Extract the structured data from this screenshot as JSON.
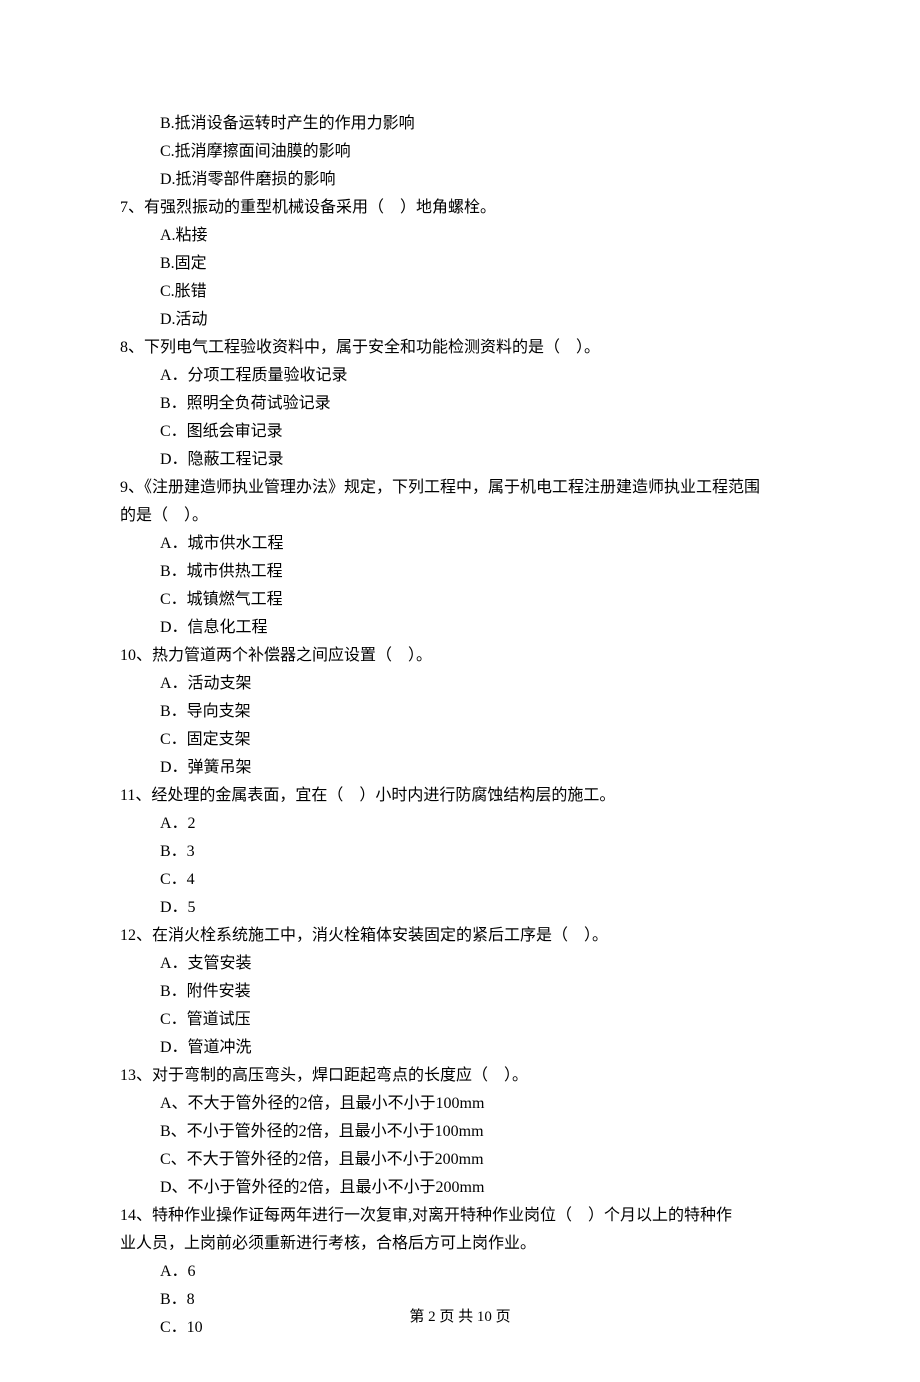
{
  "body": {
    "orphan_options": [
      "B.抵消设备运转时产生的作用力影响",
      "C.抵消摩擦面间油膜的影响",
      "D.抵消零部件磨损的影响"
    ],
    "questions": [
      {
        "num": "7",
        "stem_before": "、有强烈振动的重型机械设备采用（",
        "stem_after": "）地角螺栓。",
        "options": [
          "A.粘接",
          "B.固定",
          "C.胀错",
          "D.活动"
        ]
      },
      {
        "num": "8",
        "stem_before": "、下列电气工程验收资料中，属于安全和功能检测资料的是（",
        "stem_after": "）。",
        "options": [
          "A．分项工程质量验收记录",
          "B．照明全负荷试验记录",
          "C．图纸会审记录",
          "D．隐蔽工程记录"
        ]
      },
      {
        "num": "9",
        "stem_before": "、《注册建造师执业管理办法》规定，下列工程中，属于机电工程注册建造师执业工程范围",
        "stem_after": "",
        "stem_line2_before": "的是（",
        "stem_line2_after": "）。",
        "options": [
          "A．城市供水工程",
          "B．城市供热工程",
          "C．城镇燃气工程",
          "D．信息化工程"
        ]
      },
      {
        "num": "10",
        "stem_before": "、热力管道两个补偿器之间应设置（",
        "stem_after": "）。",
        "options": [
          "A．活动支架",
          "B．导向支架",
          "C．固定支架",
          "D．弹簧吊架"
        ]
      },
      {
        "num": "11",
        "stem_before": "、经处理的金属表面，宜在（",
        "stem_after": "）小时内进行防腐蚀结构层的施工。",
        "options": [
          "A．2",
          "B．3",
          "C．4",
          "D．5"
        ]
      },
      {
        "num": "12",
        "stem_before": "、在消火栓系统施工中，消火栓箱体安装固定的紧后工序是（",
        "stem_after": "）。",
        "options": [
          "A．支管安装",
          "B．附件安装",
          "C．管道试压",
          "D．管道冲洗"
        ]
      },
      {
        "num": "13",
        "stem_before": "、对于弯制的高压弯头，焊口距起弯点的长度应（",
        "stem_after": "）。",
        "options": [
          "A、不大于管外径的2倍，且最小不小于100mm",
          "B、不小于管外径的2倍，且最小不小于100mm",
          "C、不大于管外径的2倍，且最小不小于200mm",
          "D、不小于管外径的2倍，且最小不小于200mm"
        ]
      },
      {
        "num": "14",
        "stem_before": "、特种作业操作证每两年进行一次复审,对离开特种作业岗位（",
        "stem_after": "）个月以上的特种作",
        "stem_line2_before": "业人员，上岗前必须重新进行考核，合格后方可上岗作业。",
        "stem_line2_after": "",
        "options": [
          "A．6",
          "B．8",
          "C．10"
        ]
      }
    ]
  },
  "footer": "第 2 页 共 10 页"
}
